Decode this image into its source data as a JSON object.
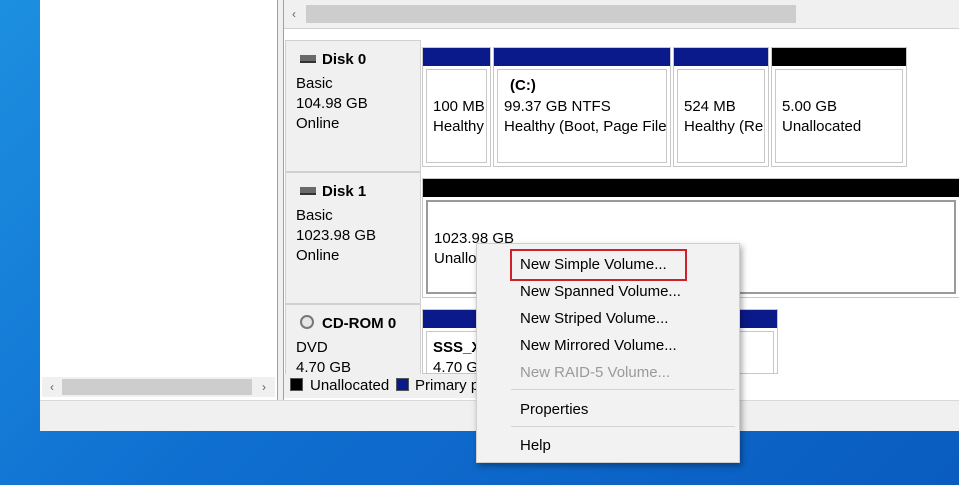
{
  "colors": {
    "primary": "#0a1a8a",
    "unallocated": "#000000",
    "highlight": "#d0202a"
  },
  "disks": [
    {
      "name": "Disk 0",
      "type": "Basic",
      "size": "104.98 GB",
      "status": "Online",
      "partitions": [
        {
          "label": "",
          "size": "100 MB",
          "status": "Healthy"
        },
        {
          "label": "(C:)",
          "size": "99.37 GB NTFS",
          "status": "Healthy (Boot, Page File,"
        },
        {
          "label": "",
          "size": "524 MB",
          "status": "Healthy (Re"
        },
        {
          "label": "",
          "size": "5.00 GB",
          "status": "Unallocated"
        }
      ]
    },
    {
      "name": "Disk 1",
      "type": "Basic",
      "size": "1023.98 GB",
      "status": "Online",
      "partitions": [
        {
          "size": "1023.98 GB",
          "status": "Unalloc"
        }
      ]
    },
    {
      "name": "CD-ROM 0",
      "type": "DVD",
      "size": "4.70 GB",
      "partitions": [
        {
          "label": "SSS_X6",
          "size": "4.70 GI"
        }
      ]
    }
  ],
  "legend": {
    "unallocated": "Unallocated",
    "primary": "Primary p"
  },
  "context_menu": {
    "items": [
      "New Simple Volume...",
      "New Spanned Volume...",
      "New Striped Volume...",
      "New Mirrored Volume...",
      "New RAID-5 Volume...",
      "Properties",
      "Help"
    ]
  },
  "scroll_arrows": {
    "left": "‹",
    "right": "›"
  }
}
